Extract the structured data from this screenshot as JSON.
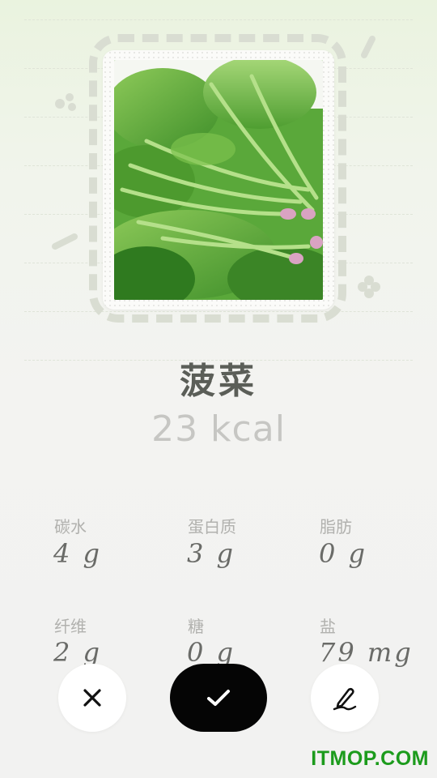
{
  "food": {
    "name": "菠菜",
    "calories": "23 kcal",
    "image_icon": "spinach-photo"
  },
  "nutrients": [
    {
      "label": "碳水",
      "value": "4 g"
    },
    {
      "label": "蛋白质",
      "value": "3 g"
    },
    {
      "label": "脂肪",
      "value": "0 g"
    },
    {
      "label": "纤维",
      "value": "2 g"
    },
    {
      "label": "糖",
      "value": "0 g"
    },
    {
      "label": "盐",
      "value": "79 mg"
    }
  ],
  "actions": {
    "cancel_icon": "close-icon",
    "confirm_icon": "check-icon",
    "edit_icon": "pen-icon"
  },
  "watermark": "ITMOP.COM",
  "colors": {
    "confirm_bg": "#050505",
    "title": "#5b5e58",
    "watermark": "#1c9b1c"
  }
}
